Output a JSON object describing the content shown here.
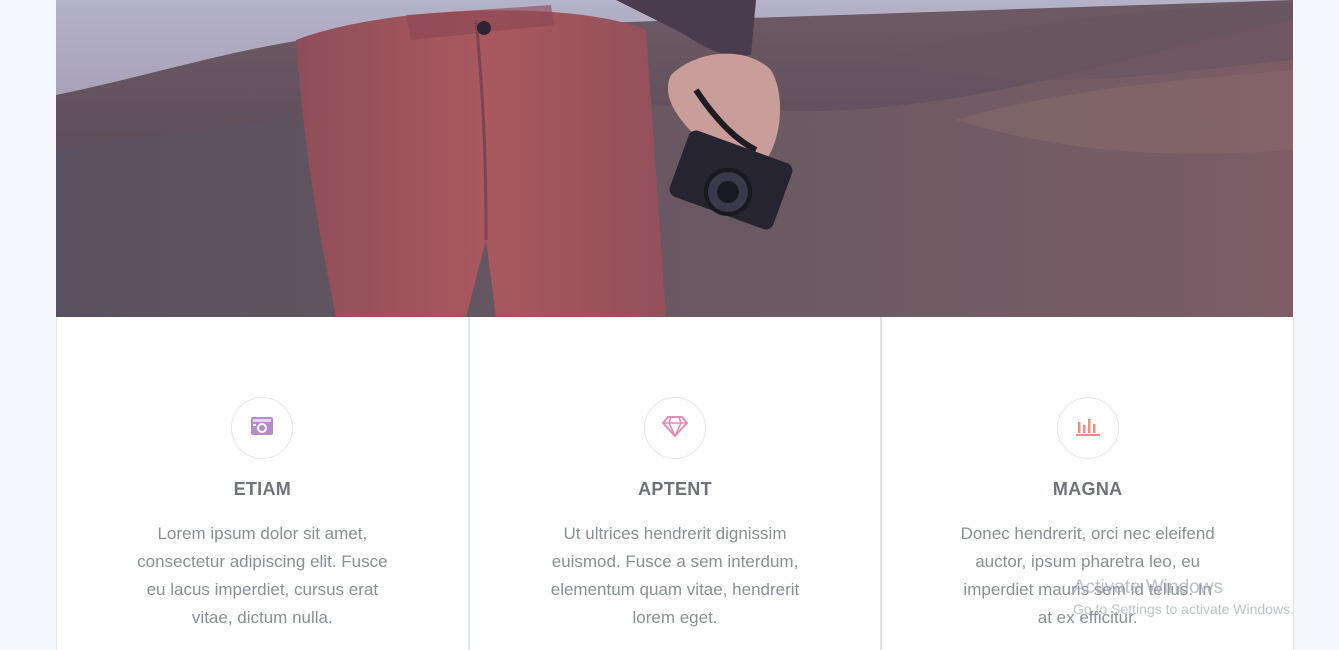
{
  "hero": {
    "image": "person-holding-camera-photo"
  },
  "features": [
    {
      "icon": "camera-icon",
      "icon_color": "#b889cf",
      "title": "ETIAM",
      "text": "Lorem ipsum dolor sit amet, consectetur adipiscing elit. Fusce eu lacus imperdiet, cursus erat vitae, dictum nulla."
    },
    {
      "icon": "diamond-icon",
      "icon_color": "#e38ab5",
      "title": "APTENT",
      "text": "Ut ultrices hendrerit dignissim euismod. Fusce a sem interdum, elementum quam vitae, hendrerit lorem eget."
    },
    {
      "icon": "bar-chart-icon",
      "icon_color": "#ee8e82",
      "title": "MAGNA",
      "text": "Donec hendrerit, orci nec eleifend auctor, ipsum pharetra leo, eu imperdiet mauris sem id tellus. In at ex efficitur."
    }
  ],
  "watermark": {
    "title": "Activate Windows",
    "subtitle": "Go to Settings to activate Windows."
  }
}
